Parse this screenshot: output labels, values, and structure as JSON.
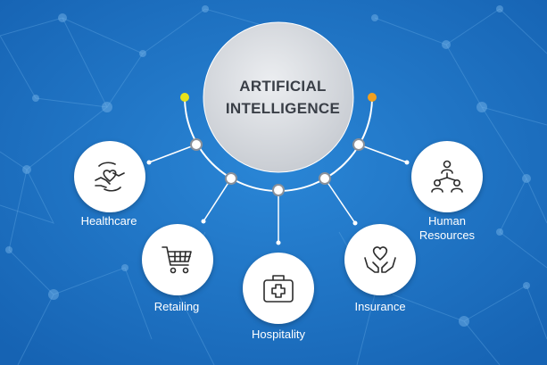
{
  "hub": {
    "line1": "ARTIFICIAL",
    "line2": "INTELLIGENCE"
  },
  "branches": {
    "healthcare": {
      "label": "Healthcare",
      "icon": "hands-heart-icon"
    },
    "retailing": {
      "label": "Retailing",
      "icon": "shopping-cart-icon"
    },
    "hospitality": {
      "label": "Hospitality",
      "icon": "first-aid-kit-icon"
    },
    "insurance": {
      "label": "Insurance",
      "icon": "hands-holding-heart-icon"
    },
    "human_resources": {
      "label_line1": "Human",
      "label_line2": "Resources",
      "icon": "people-network-icon"
    }
  },
  "colors": {
    "background": "#1e6fc0",
    "hub_fill": "#d7dadf",
    "accent_yellow": "#e8e21a",
    "accent_orange": "#f0a020",
    "connector": "#ffffff",
    "icon_stroke": "#2b2b2b"
  }
}
